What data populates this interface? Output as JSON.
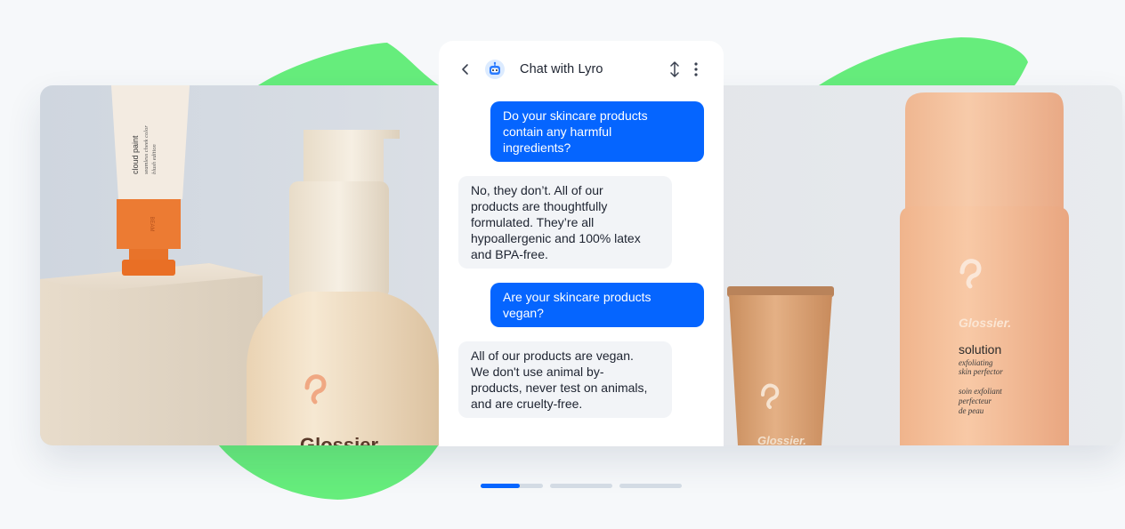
{
  "chat": {
    "title": "Chat with Lyro",
    "messages": [
      {
        "role": "user",
        "text": "Do your skincare products\ncontain any harmful\ningredients?"
      },
      {
        "role": "bot",
        "text": "No, they don’t. All of our\nproducts are thoughtfully\nformulated. They’re all\nhypoallergenic and 100% latex\nand BPA-free."
      },
      {
        "role": "user",
        "text": "Are your skincare products\nvegan?"
      },
      {
        "role": "bot",
        "text": "All of our products are vegan.\nWe don't use animal by-\nproducts, never test on animals,\nand are cruelty-free."
      }
    ]
  },
  "products": {
    "tube_left": {
      "line1": "cloud paint",
      "line2": "seamless cheek color",
      "line3": "blush edition",
      "cap_text": "BEAM"
    },
    "bottle_center": {
      "brand": "Glossier."
    },
    "tube_small": {
      "brand": "Glossier."
    },
    "bottle_right": {
      "brand": "Glossier.",
      "name": "solution",
      "sub1": "exfoliating",
      "sub2": "skin perfector",
      "fr1": "soin exfoliant",
      "fr2": "perfecteur",
      "fr3": "de peau"
    }
  },
  "carousel": {
    "slides": 3,
    "active_index": 0,
    "active_progress": 0.63
  },
  "colors": {
    "accent": "#0565ff",
    "green_blob": "#66ed7c",
    "bot_bubble": "#f2f4f7",
    "pager_track": "#d3dbe4"
  },
  "icons": [
    "chevron-left-icon",
    "lyro-bot-icon",
    "resize-vertical-icon",
    "more-vertical-icon"
  ]
}
